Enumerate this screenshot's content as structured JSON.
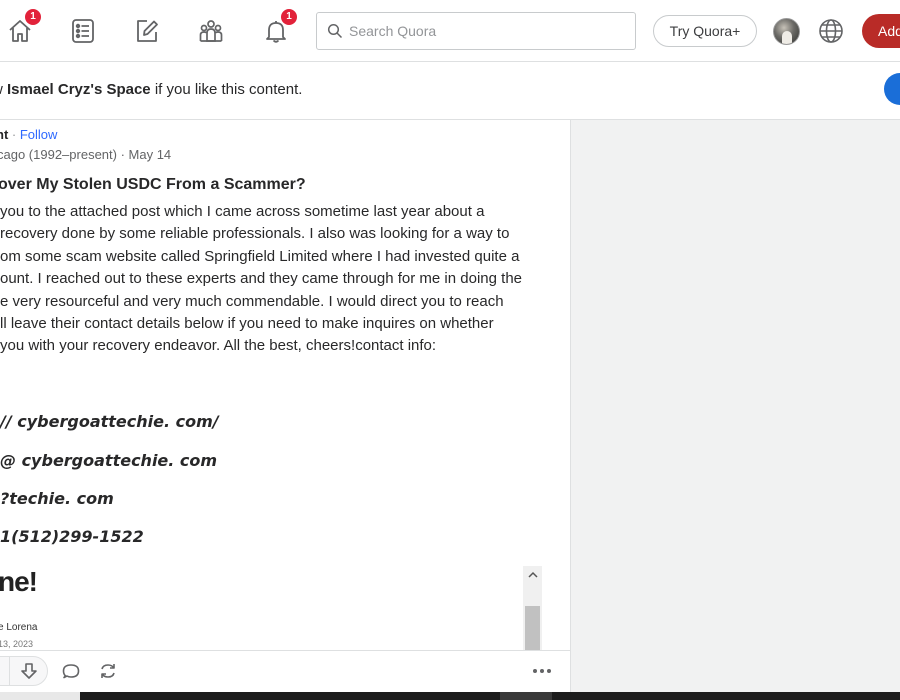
{
  "nav": {
    "home_badge": "1",
    "notifications_badge": "1",
    "search_placeholder": "Search Quora",
    "try_label": "Try Quora+",
    "add_label": "Add"
  },
  "banner": {
    "prefix": "w ",
    "space_name": "Ismael Cryz's Space",
    "suffix": " if you like this content."
  },
  "post": {
    "author_fragment": "nt",
    "separator": " · ",
    "follow_label": "Follow",
    "credential": "cago (1992–present) · May 14",
    "question": "over My Stolen USDC From a Scammer?",
    "answer_lines": [
      "you to the attached post which I came across sometime last year about a",
      "recovery done by some reliable professionals. I also was looking for a way to",
      "om some scam website called Springfield Limited where I had invested quite a",
      "ount. I reached out to these experts and they came through for me in doing the",
      "e very resourceful and very much commendable. I would direct you to reach",
      "ll leave their contact details below if you need to make inquires on whether",
      " you with your recovery endeavor. All the best, cheers!contact info:"
    ],
    "contacts": [
      "// cybergoattechie. com/",
      "@ cybergoattechie. com",
      "?techie. com",
      "1(512)299-1522"
    ]
  },
  "embed": {
    "title": "ne!",
    "author": "e Lorena",
    "date": "13, 2023"
  },
  "colors": {
    "brand_red": "#b92b27",
    "link_blue": "#2e69ff",
    "badge_red": "#e2223a"
  }
}
